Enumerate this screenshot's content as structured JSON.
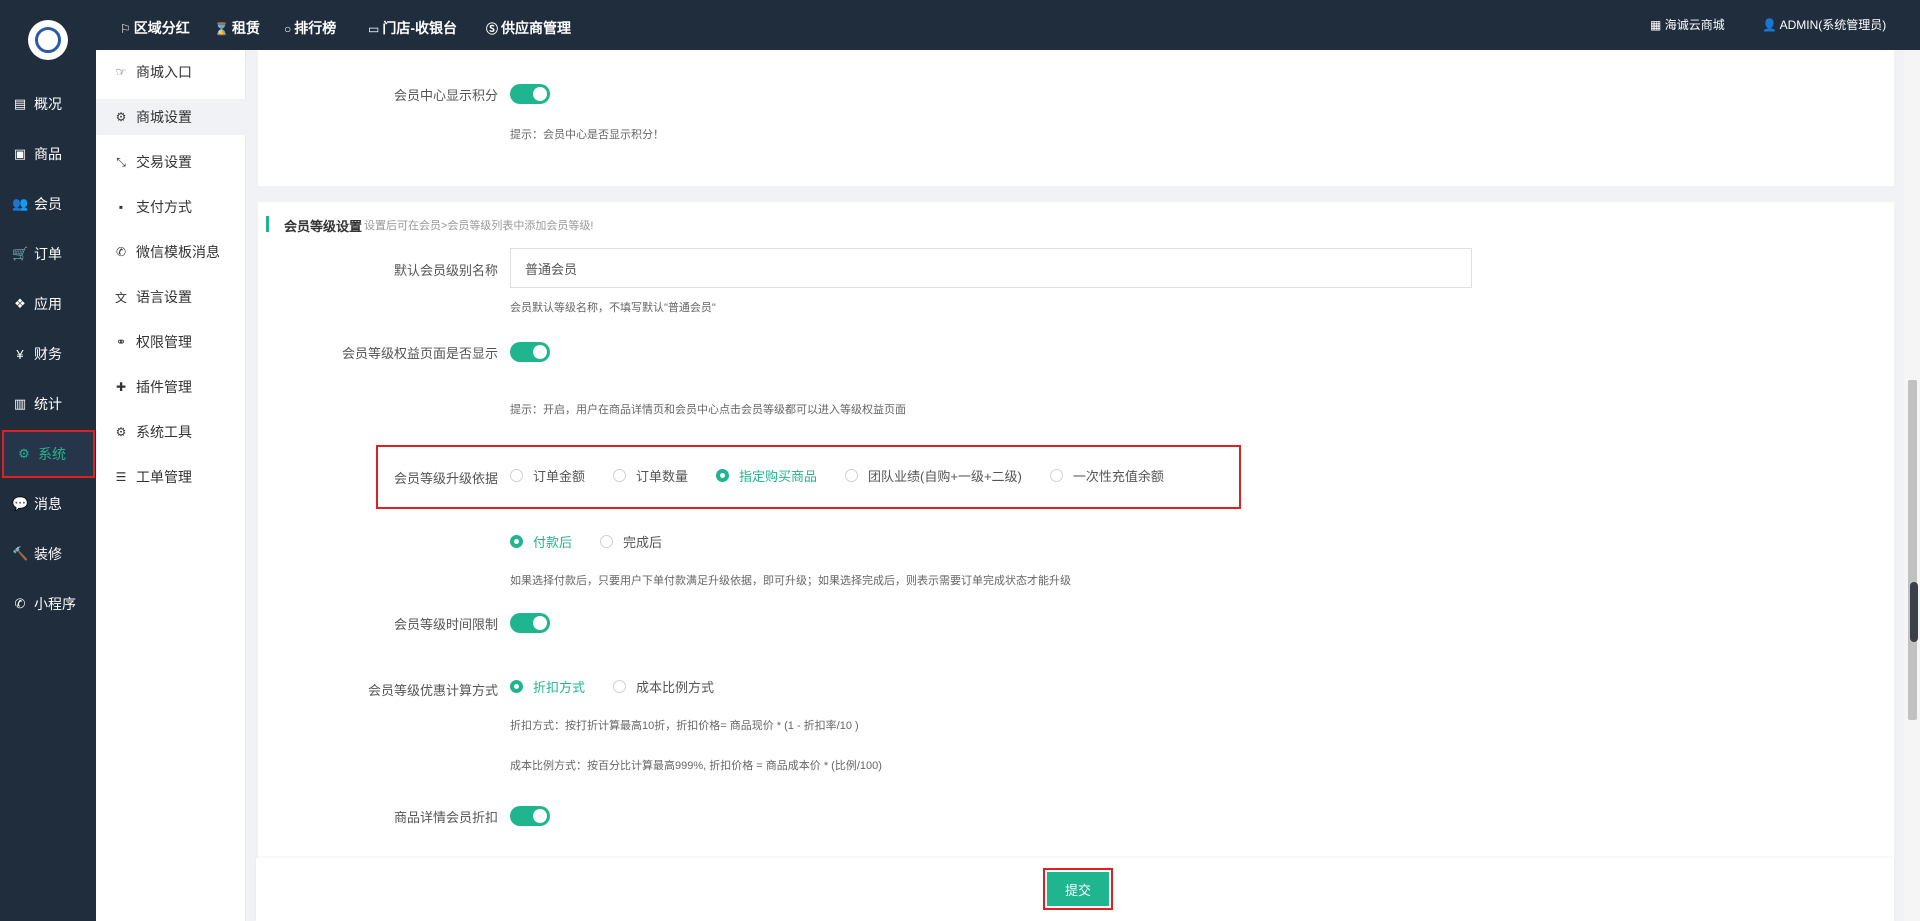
{
  "left_nav": {
    "items": [
      {
        "label": "概况",
        "icon": "archive-icon",
        "glyph": "▤"
      },
      {
        "label": "商品",
        "icon": "box-icon",
        "glyph": "▣"
      },
      {
        "label": "会员",
        "icon": "users-icon",
        "glyph": "👥"
      },
      {
        "label": "订单",
        "icon": "cart-icon",
        "glyph": "🛒"
      },
      {
        "label": "应用",
        "icon": "apps-icon",
        "glyph": "❖"
      },
      {
        "label": "财务",
        "icon": "yen-icon",
        "glyph": "¥"
      },
      {
        "label": "统计",
        "icon": "bar-chart-icon",
        "glyph": "▥"
      },
      {
        "label": "系统",
        "icon": "gears-icon",
        "glyph": "⚙"
      },
      {
        "label": "消息",
        "icon": "comment-icon",
        "glyph": "💬"
      },
      {
        "label": "装修",
        "icon": "hammer-icon",
        "glyph": "🔨"
      },
      {
        "label": "小程序",
        "icon": "wechat-icon",
        "glyph": "✆"
      }
    ],
    "active_label": "系统"
  },
  "topbar": {
    "links": [
      {
        "label": "区域分红",
        "icon": "flag-icon",
        "glyph": "⚐"
      },
      {
        "label": "租赁",
        "icon": "hourglass-icon",
        "glyph": "⌛"
      },
      {
        "label": "排行榜",
        "icon": "circle-icon",
        "glyph": "○"
      },
      {
        "label": "门店-收银台",
        "icon": "monitor-icon",
        "glyph": "▭"
      },
      {
        "label": "供应商管理",
        "icon": "skype-icon",
        "glyph": "Ⓢ"
      }
    ],
    "shop_label": "海诚云商城",
    "shop_icon_glyph": "▦",
    "user_label": "ADMIN(系统管理员)",
    "user_icon_glyph": "👤"
  },
  "sub_nav": {
    "items": [
      {
        "label": "商城入口",
        "icon": "hand-point-icon",
        "glyph": "☞"
      },
      {
        "label": "商城设置",
        "icon": "gear-icon",
        "glyph": "⚙"
      },
      {
        "label": "交易设置",
        "icon": "exchange-icon",
        "glyph": "⤡"
      },
      {
        "label": "支付方式",
        "icon": "payment-icon",
        "glyph": "▪"
      },
      {
        "label": "微信模板消息",
        "icon": "wechat-icon",
        "glyph": "✆"
      },
      {
        "label": "语言设置",
        "icon": "language-icon",
        "glyph": "文"
      },
      {
        "label": "权限管理",
        "icon": "link-icon",
        "glyph": "⚭"
      },
      {
        "label": "插件管理",
        "icon": "puzzle-icon",
        "glyph": "✚"
      },
      {
        "label": "系统工具",
        "icon": "gear-icon",
        "glyph": "⚙"
      },
      {
        "label": "工单管理",
        "icon": "list-icon",
        "glyph": "☰"
      }
    ],
    "active_label": "商城设置"
  },
  "card1": {
    "points_label": "会员中心显示积分",
    "points_hint": "提示：会员中心是否显示积分！"
  },
  "level_section": {
    "title": "会员等级设置",
    "subtitle": "设置后可在会员>会员等级列表中添加会员等级!",
    "default_name_label": "默认会员级别名称",
    "default_name_value": "普通会员",
    "default_name_hint": "会员默认等级名称，不填写默认\"普通会员\"",
    "benefit_page_label": "会员等级权益页面是否显示",
    "benefit_page_hint": "提示：开启，用户在商品详情页和会员中心点击会员等级都可以进入等级权益页面",
    "upgrade_basis_label": "会员等级升级依据",
    "upgrade_basis_options": [
      "订单金额",
      "订单数量",
      "指定购买商品",
      "团队业绩(自购+一级+二级)",
      "一次性充值余额"
    ],
    "upgrade_basis_selected": 2,
    "upgrade_timing_options": [
      "付款后",
      "完成后"
    ],
    "upgrade_timing_selected": 0,
    "upgrade_timing_hint": "如果选择付款后，只要用户下单付款满足升级依据，即可升级；如果选择完成后，则表示需要订单完成状态才能升级",
    "time_limit_label": "会员等级时间限制",
    "discount_calc_label": "会员等级优惠计算方式",
    "discount_calc_options": [
      "折扣方式",
      "成本比例方式"
    ],
    "discount_calc_selected": 0,
    "discount_hint_1": "折扣方式：按打折计算最高10折，折扣价格= 商品现价 * (1 - 折扣率/10 )",
    "discount_hint_2": "成本比例方式：按百分比计算最高999%, 折扣价格 = 商品成本价 * (比例/100)",
    "detail_discount_label": "商品详情会员折扣"
  },
  "footer": {
    "submit_label": "提交"
  },
  "colors": {
    "accent": "#1fb58f",
    "nav_bg": "#1f2d3d",
    "highlight": "#e02020"
  }
}
